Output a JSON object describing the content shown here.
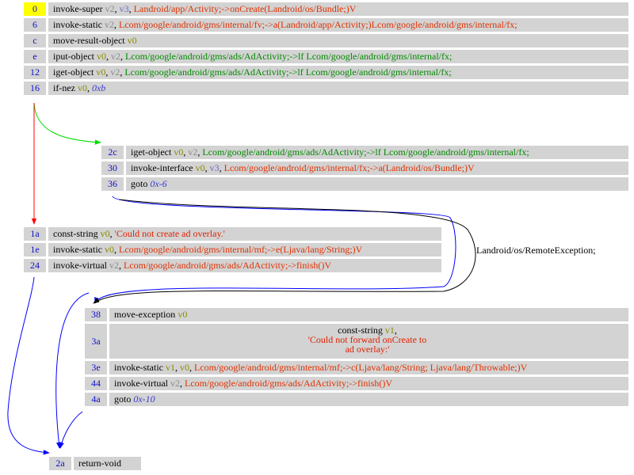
{
  "blocks": [
    {
      "id": "block-0",
      "rows": [
        {
          "offset": "0",
          "highlight": true,
          "op": "invoke-super",
          "args": [
            [
              "v2",
              "reg"
            ],
            [
              ", ",
              "sep"
            ],
            [
              "v3",
              "reg3"
            ],
            [
              ", ",
              "sep"
            ],
            [
              "Landroid/app/Activity;->onCreate(Landroid/os/Bundle;)V",
              "meth"
            ]
          ]
        },
        {
          "offset": "6",
          "op": "invoke-static",
          "args": [
            [
              "v2",
              "reg"
            ],
            [
              ", ",
              "sep"
            ],
            [
              "Lcom/google/android/gms/internal/fv;->a(Landroid/app/Activity;)Lcom/google/android/gms/internal/fx;",
              "meth"
            ]
          ]
        },
        {
          "offset": "c",
          "op": "move-result-object",
          "args": [
            [
              "v0",
              "regv0"
            ]
          ]
        },
        {
          "offset": "e",
          "op": "iput-object",
          "args": [
            [
              "v0",
              "regv0"
            ],
            [
              ", ",
              "sep"
            ],
            [
              "v2",
              "reg"
            ],
            [
              ", ",
              "sep"
            ],
            [
              "Lcom/google/android/gms/ads/AdActivity;->lf Lcom/google/android/gms/internal/fx;",
              "field"
            ]
          ]
        },
        {
          "offset": "12",
          "op": "iget-object",
          "args": [
            [
              "v0",
              "regv0"
            ],
            [
              ", ",
              "sep"
            ],
            [
              "v2",
              "reg"
            ],
            [
              ", ",
              "sep"
            ],
            [
              "Lcom/google/android/gms/ads/AdActivity;->lf Lcom/google/android/gms/internal/fx;",
              "field"
            ]
          ]
        },
        {
          "offset": "16",
          "op": "if-nez",
          "args": [
            [
              "v0",
              "regv0"
            ],
            [
              ", ",
              "sep"
            ],
            [
              "0xb",
              "lbl"
            ]
          ]
        }
      ]
    },
    {
      "id": "block-2c",
      "rows": [
        {
          "offset": "2c",
          "op": "iget-object",
          "args": [
            [
              "v0",
              "regv0"
            ],
            [
              ", ",
              "sep"
            ],
            [
              "v2",
              "reg"
            ],
            [
              ", ",
              "sep"
            ],
            [
              "Lcom/google/android/gms/ads/AdActivity;->lf Lcom/google/android/gms/internal/fx;",
              "field"
            ]
          ]
        },
        {
          "offset": "30",
          "op": "invoke-interface",
          "args": [
            [
              "v0",
              "regv0"
            ],
            [
              ", ",
              "sep"
            ],
            [
              "v3",
              "reg3"
            ],
            [
              ", ",
              "sep"
            ],
            [
              "Lcom/google/android/gms/internal/fx;->a(Landroid/os/Bundle;)V",
              "meth"
            ]
          ]
        },
        {
          "offset": "36",
          "op": "goto",
          "args": [
            [
              "0x-6",
              "lbl"
            ]
          ]
        }
      ]
    },
    {
      "id": "block-1a",
      "rows": [
        {
          "offset": "1a",
          "op": "const-string",
          "args": [
            [
              "v0",
              "regv0"
            ],
            [
              ", ",
              "sep"
            ],
            [
              "'Could not create ad overlay.'",
              "str"
            ]
          ]
        },
        {
          "offset": "1e",
          "op": "invoke-static",
          "args": [
            [
              "v0",
              "regv0"
            ],
            [
              ", ",
              "sep"
            ],
            [
              "Lcom/google/android/gms/internal/mf;->e(Ljava/lang/String;)V",
              "meth"
            ]
          ]
        },
        {
          "offset": "24",
          "op": "invoke-virtual",
          "args": [
            [
              "v2",
              "reg"
            ],
            [
              ", ",
              "sep"
            ],
            [
              "Lcom/google/android/gms/ads/AdActivity;->finish()V",
              "meth"
            ]
          ]
        }
      ]
    },
    {
      "id": "block-38",
      "rows": [
        {
          "offset": "38",
          "op": "move-exception",
          "args": [
            [
              "v0",
              "regv0"
            ]
          ]
        },
        {
          "offset": "3a",
          "tall": true,
          "lines": [
            [
              [
                "const-string",
                "op"
              ],
              [
                "  ",
                "sep"
              ],
              [
                "v1",
                "regv0"
              ],
              [
                ",",
                "sep"
              ]
            ],
            [
              [
                "'Could not forward onCreate to",
                "str"
              ]
            ],
            [
              [
                "ad overlay:'",
                "str"
              ]
            ]
          ]
        },
        {
          "offset": "3e",
          "op": "invoke-static",
          "args": [
            [
              "v1",
              "regv0"
            ],
            [
              ", ",
              "sep"
            ],
            [
              "v0",
              "regv0"
            ],
            [
              ", ",
              "sep"
            ],
            [
              "Lcom/google/android/gms/internal/mf;->c(Ljava/lang/String; Ljava/lang/Throwable;)V",
              "meth"
            ]
          ]
        },
        {
          "offset": "44",
          "op": "invoke-virtual",
          "args": [
            [
              "v2",
              "reg"
            ],
            [
              ", ",
              "sep"
            ],
            [
              "Lcom/google/android/gms/ads/AdActivity;->finish()V",
              "meth"
            ]
          ]
        },
        {
          "offset": "4a",
          "op": "goto",
          "args": [
            [
              "0x-10",
              "lbl"
            ]
          ]
        }
      ]
    },
    {
      "id": "block-2a",
      "rows": [
        {
          "offset": "2a",
          "op": "return-void",
          "args": []
        }
      ]
    }
  ],
  "edges": {
    "exception_label": "Landroid/os/RemoteException;"
  },
  "colors": {
    "row_bg": "#d3d3d3",
    "highlight": "#ffff00",
    "offset_text": "#1010c8",
    "edge_true": "#00dd00",
    "edge_false": "#ff0000",
    "edge_normal": "#0000ff",
    "edge_exception": "#000000"
  }
}
